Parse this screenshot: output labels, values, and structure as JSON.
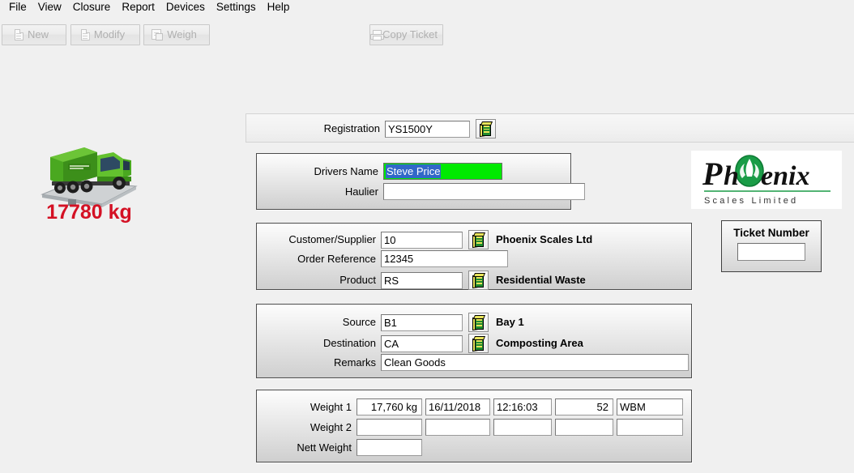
{
  "menu": {
    "items": [
      "File",
      "View",
      "Closure",
      "Report",
      "Devices",
      "Settings",
      "Help"
    ]
  },
  "toolbar": {
    "new_label": "New",
    "modify_label": "Modify",
    "weigh_label": "Weigh",
    "copy_ticket_label": "Copy Ticket"
  },
  "weight_display": {
    "value": "17780 kg",
    "color": "#d41124"
  },
  "registration": {
    "label": "Registration",
    "value": "YS1500Y"
  },
  "driver_panel": {
    "drivers_name_label": "Drivers Name",
    "drivers_name_value": "Steve Price",
    "haulier_label": "Haulier",
    "haulier_value": "",
    "focus_bg": "#00ea00",
    "selection_bg": "#3168c8"
  },
  "customer_panel": {
    "customer_label": "Customer/Supplier",
    "customer_value": "10",
    "customer_resolved": "Phoenix Scales Ltd",
    "order_label": "Order Reference",
    "order_value": "12345",
    "product_label": "Product",
    "product_value": "RS",
    "product_resolved": "Residential Waste"
  },
  "source_panel": {
    "source_label": "Source",
    "source_value": "B1",
    "source_resolved": "Bay 1",
    "destination_label": "Destination",
    "destination_value": "CA",
    "destination_resolved": "Composting Area",
    "remarks_label": "Remarks",
    "remarks_value": "Clean Goods"
  },
  "weights_panel": {
    "weight1_label": "Weight 1",
    "weight2_label": "Weight 2",
    "nett_label": "Nett Weight",
    "weight1": {
      "weight": "17,760 kg",
      "date": "16/11/2018",
      "time": "12:16:03",
      "number": "52",
      "code": "WBM"
    },
    "weight2": {
      "weight": "",
      "date": "",
      "time": "",
      "number": "",
      "code": ""
    },
    "nett": {
      "weight": ""
    }
  },
  "logo": {
    "name": "Phoenix",
    "subtitle": "S c a l e s   L i m i t e d",
    "accent": "#119944"
  },
  "ticket": {
    "title": "Ticket Number",
    "value": ""
  }
}
